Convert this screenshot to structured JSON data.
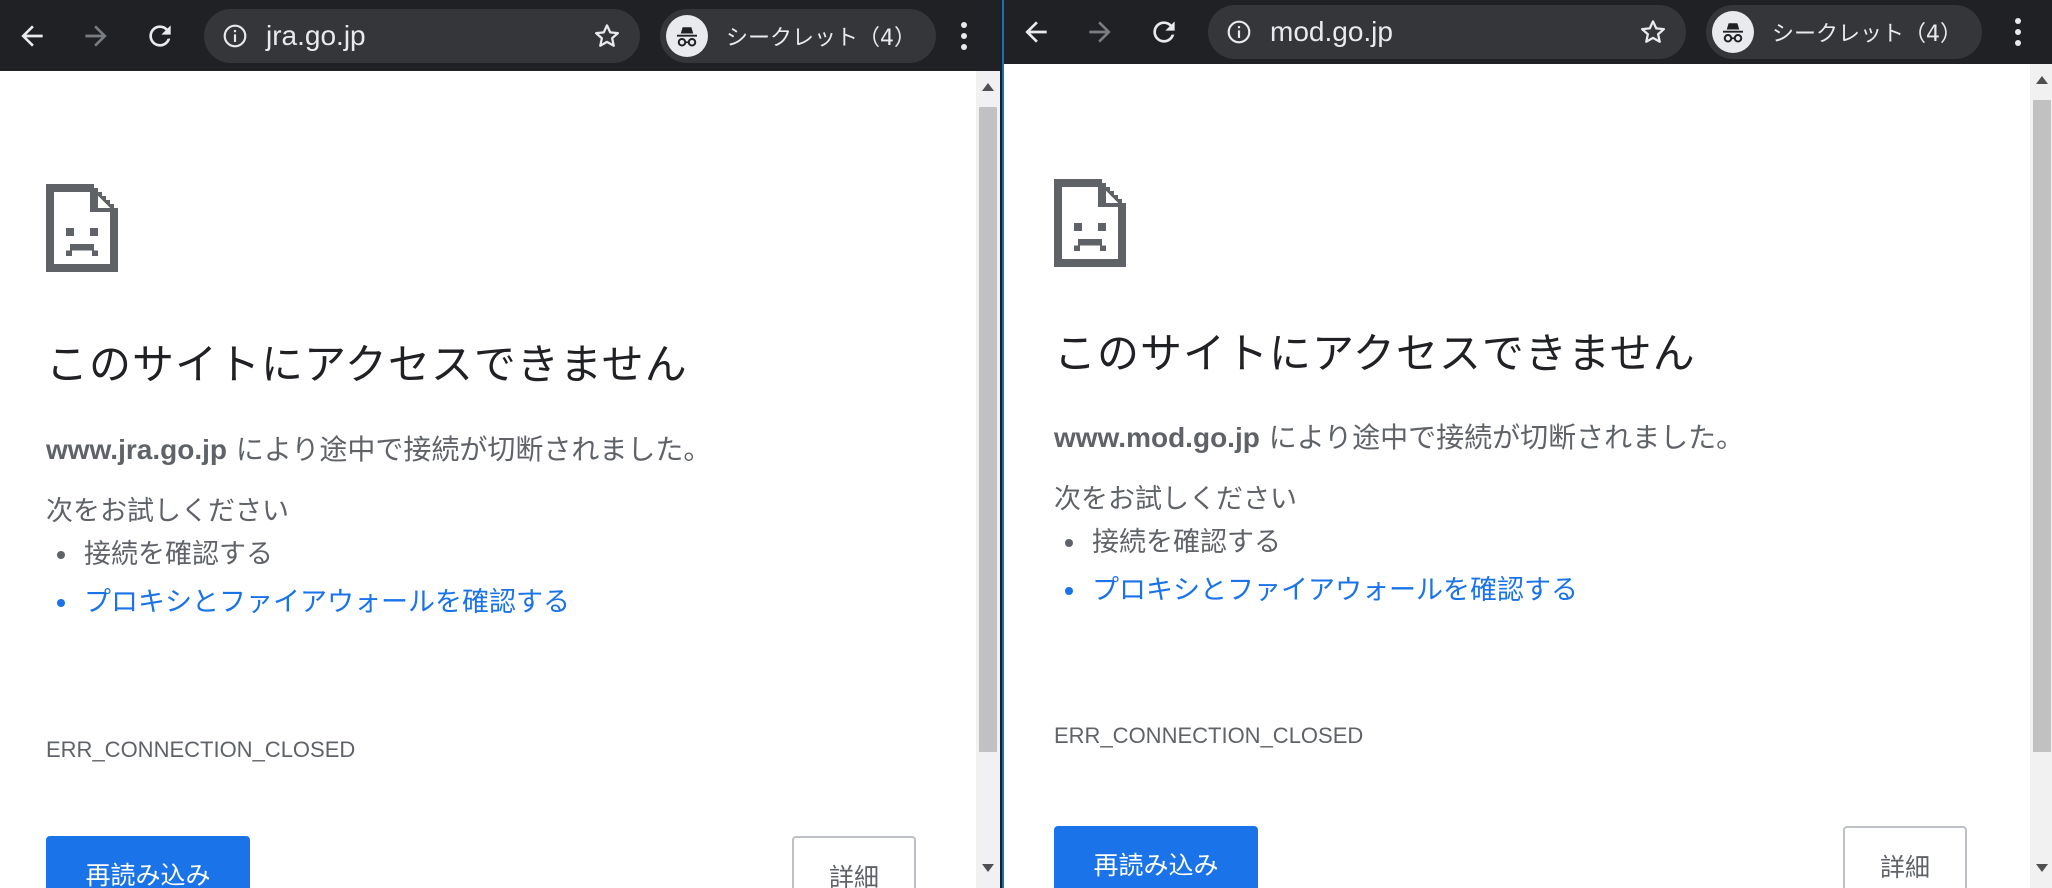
{
  "left_window": {
    "url": "jra.go.jp",
    "incognito_label": "シークレット（4）",
    "heading": "このサイトにアクセスできません",
    "host": "www.jra.go.jp",
    "message": " により途中で接続が切断されました。",
    "try_label": "次をお試しください",
    "suggestions": [
      "接続を確認する",
      "プロキシとファイアウォールを確認する"
    ],
    "error_code": "ERR_CONNECTION_CLOSED",
    "reload_label": "再読み込み",
    "details_label": "詳細"
  },
  "right_window": {
    "url": "mod.go.jp",
    "incognito_label": "シークレット（4）",
    "heading": "このサイトにアクセスできません",
    "host": "www.mod.go.jp",
    "message": " により途中で接続が切断されました。",
    "try_label": "次をお試しください",
    "suggestions": [
      "接続を確認する",
      "プロキシとファイアウォールを確認する"
    ],
    "error_code": "ERR_CONNECTION_CLOSED",
    "reload_label": "再読み込み",
    "details_label": "詳細"
  },
  "icons": {
    "back": "arrow-left-icon",
    "forward": "arrow-right-icon",
    "reload": "reload-icon",
    "site_info": "info-icon",
    "bookmark": "star-icon",
    "incognito": "incognito-icon",
    "menu": "kebab-menu-icon",
    "error": "sad-document-icon"
  },
  "colors": {
    "toolbar": "#202124",
    "omnibox": "#35363a",
    "link": "#1a73e8",
    "primary_button": "#1a73e8",
    "text": "#202124",
    "secondary_text": "#5f6368"
  }
}
